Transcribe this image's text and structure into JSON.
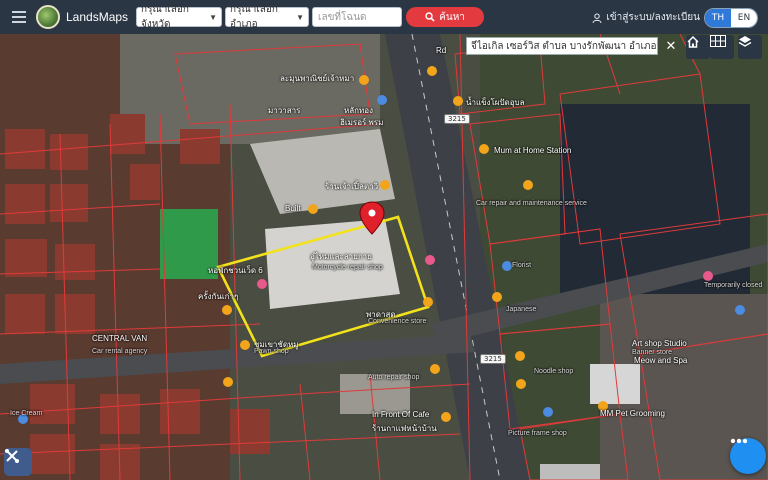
{
  "header": {
    "brand": "LandsMaps",
    "province_select": "กรุณาเลือกจังหวัด",
    "district_select": "กรุณาเลือกอำเภอ",
    "deed_placeholder": "เลขที่โฉนด",
    "search_label": "ค้นหา",
    "login_label": "เข้าสู่ระบบ/ลงทะเบียน",
    "lang": [
      "TH",
      "EN"
    ]
  },
  "map": {
    "address": "จีไอเกิล เซอร์วิส ตำบล บางรักพัฒนา อำเภอบา",
    "road_tags": [
      "3215",
      "3215"
    ],
    "labels": {
      "l1": "Rd",
      "l2": "ละมุนพาณิชย์เจ้าหมา",
      "l3": "มาวาสาร",
      "l4": "หลักทอง",
      "l5": "ฮิเมรอร์ พรม",
      "l6": "Mum at Home Station",
      "l7": "น้ำแข็งโผปัดอุบล",
      "l8": "Built",
      "l9": "ร้านเจ้าเปิ้ลตาวิ",
      "l10": "อู่ไหมและลายกาย",
      "l11": "Motorcycle repair shop",
      "l12": "หอพักชวนเว็ด 6",
      "l13": "ครั้งกันเก่าๆ",
      "l14": "CENTRAL VAN",
      "l15": "Car rental agency",
      "l16": "ชุมเขาชัดหมู",
      "l17": "Pawn shop",
      "l18": "พาดาสุด",
      "l19": "Convenience store",
      "l20": "Auto repair shop",
      "l21": "In Front Of Cafe",
      "l22": "ร้านกาแฟหน้าบ้าน",
      "l23": "Art shop Studio",
      "l24": "Banner store",
      "l25": "Meow and Spa",
      "l26": "Noodle shop",
      "l27": "MM Pet Grooming",
      "l28": "Picture frame shop",
      "l29": "Ice Cream",
      "l30": "Japanese",
      "l31": "Temporarily closed",
      "l32": "Car repair and maintenance service",
      "l33": "Florist"
    }
  },
  "icons": {
    "menu": "menu-icon",
    "search": "search-icon",
    "user": "user-icon",
    "close": "close-icon",
    "home": "home-icon",
    "grid": "grid-icon",
    "layers": "layers-icon",
    "pin": "map-pin-icon",
    "tools": "tools-icon",
    "more": "more-icon"
  },
  "colors": {
    "topbar": "#2b3645",
    "search_btn": "#e23a3f",
    "parcel_highlight": "#f2e21c",
    "parcel_lines": "#e03a3a",
    "lang_active": "#2f7ad9",
    "fab": "#1f8ff2"
  }
}
